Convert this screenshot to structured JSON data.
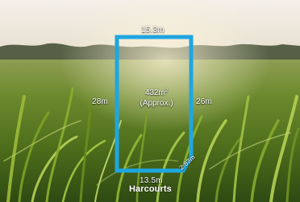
{
  "plan": {
    "area_value": "432m",
    "area_unit_sup": "2",
    "area_note": "(Approx.)",
    "top_edge": "15.3m",
    "left_edge": "28m",
    "right_edge": "26m",
    "bottom_edge": "13.5m",
    "corner_edge": "2.83m",
    "outline_color": "#1fa6e0"
  },
  "brand": {
    "name": "Harcourts"
  }
}
